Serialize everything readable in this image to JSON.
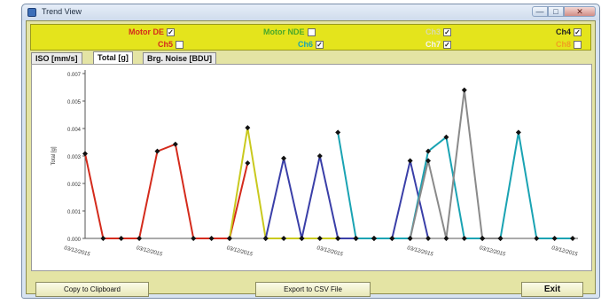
{
  "window": {
    "title": "Trend View",
    "min": "—",
    "max": "□",
    "close": "✕"
  },
  "channels": [
    {
      "label": "Motor DE",
      "checked": true,
      "color": "#d42b1c"
    },
    {
      "label": "Motor NDE",
      "checked": false,
      "color": "#4aa82a"
    },
    {
      "label": "Ch3",
      "checked": true,
      "color": "#dadab0"
    },
    {
      "label": "Ch4",
      "checked": true,
      "color": "#222222"
    },
    {
      "label": "Ch5",
      "checked": false,
      "color": "#d42b1c"
    },
    {
      "label": "Ch6",
      "checked": true,
      "color": "#1aa3b3"
    },
    {
      "label": "Ch7",
      "checked": true,
      "color": "#f4f4f4"
    },
    {
      "label": "Ch8",
      "checked": false,
      "color": "#f0a020"
    }
  ],
  "tabs": [
    {
      "label": "ISO [mm/s]",
      "active": false
    },
    {
      "label": "Total [g]",
      "active": true
    },
    {
      "label": "Brg. Noise [BDU]",
      "active": false
    }
  ],
  "buttons": {
    "copy": "Copy to Clipboard",
    "export": "Export to CSV File",
    "exit": "Exit"
  },
  "chart_data": {
    "type": "line",
    "ylabel": "Total [g]",
    "ylim": [
      0,
      0.007
    ],
    "yticks": [
      "0.000",
      "0.001",
      "0.002",
      "0.003",
      "0.004",
      "0.005",
      "0.007"
    ],
    "xtick_labels": [
      "03/12/2015",
      "03/12/2015",
      "03/12/2015",
      "03/12/2015",
      "03/12/2015",
      "03/12/2015",
      "03/12/2015"
    ],
    "x": [
      1,
      2,
      3,
      4,
      5,
      6,
      7,
      8,
      9,
      10,
      11,
      12,
      13,
      14,
      15,
      16,
      17,
      18,
      19,
      20,
      21,
      22,
      23,
      24,
      25,
      26,
      27,
      28
    ],
    "series": [
      {
        "color": "#d42b1c",
        "values": [
          0.0036,
          0,
          0,
          0,
          0.0037,
          0.004,
          0,
          0,
          0,
          0.0032,
          null,
          null,
          null,
          null,
          null,
          null,
          null,
          null,
          null,
          null,
          null,
          null,
          null,
          null,
          null,
          null,
          null,
          null
        ]
      },
      {
        "color": "#c9c91e",
        "values": [
          null,
          null,
          null,
          null,
          null,
          null,
          null,
          null,
          0,
          0.0047,
          0,
          0,
          0,
          0,
          0,
          0,
          0,
          null,
          null,
          null,
          null,
          null,
          null,
          null,
          null,
          null,
          null,
          null
        ]
      },
      {
        "color": "#3a3fa8",
        "values": [
          null,
          null,
          null,
          null,
          null,
          null,
          null,
          null,
          null,
          null,
          0,
          0.0034,
          0,
          0.0035,
          0,
          0,
          0,
          0,
          0.0033,
          0,
          null,
          null,
          null,
          null,
          null,
          null,
          null,
          null
        ]
      },
      {
        "color": "#1aa3b3",
        "values": [
          null,
          null,
          null,
          null,
          null,
          null,
          null,
          null,
          null,
          null,
          null,
          null,
          null,
          null,
          0.0045,
          0,
          0,
          0,
          0,
          0.0037,
          0.0043,
          0,
          0,
          0,
          0.0045,
          0,
          0,
          0
        ]
      },
      {
        "color": "#8a8a8a",
        "values": [
          null,
          null,
          null,
          null,
          null,
          null,
          null,
          null,
          null,
          null,
          null,
          null,
          null,
          null,
          null,
          null,
          null,
          null,
          0,
          0.0033,
          0,
          0.0063,
          0,
          0,
          null,
          null,
          null,
          null
        ]
      }
    ]
  }
}
